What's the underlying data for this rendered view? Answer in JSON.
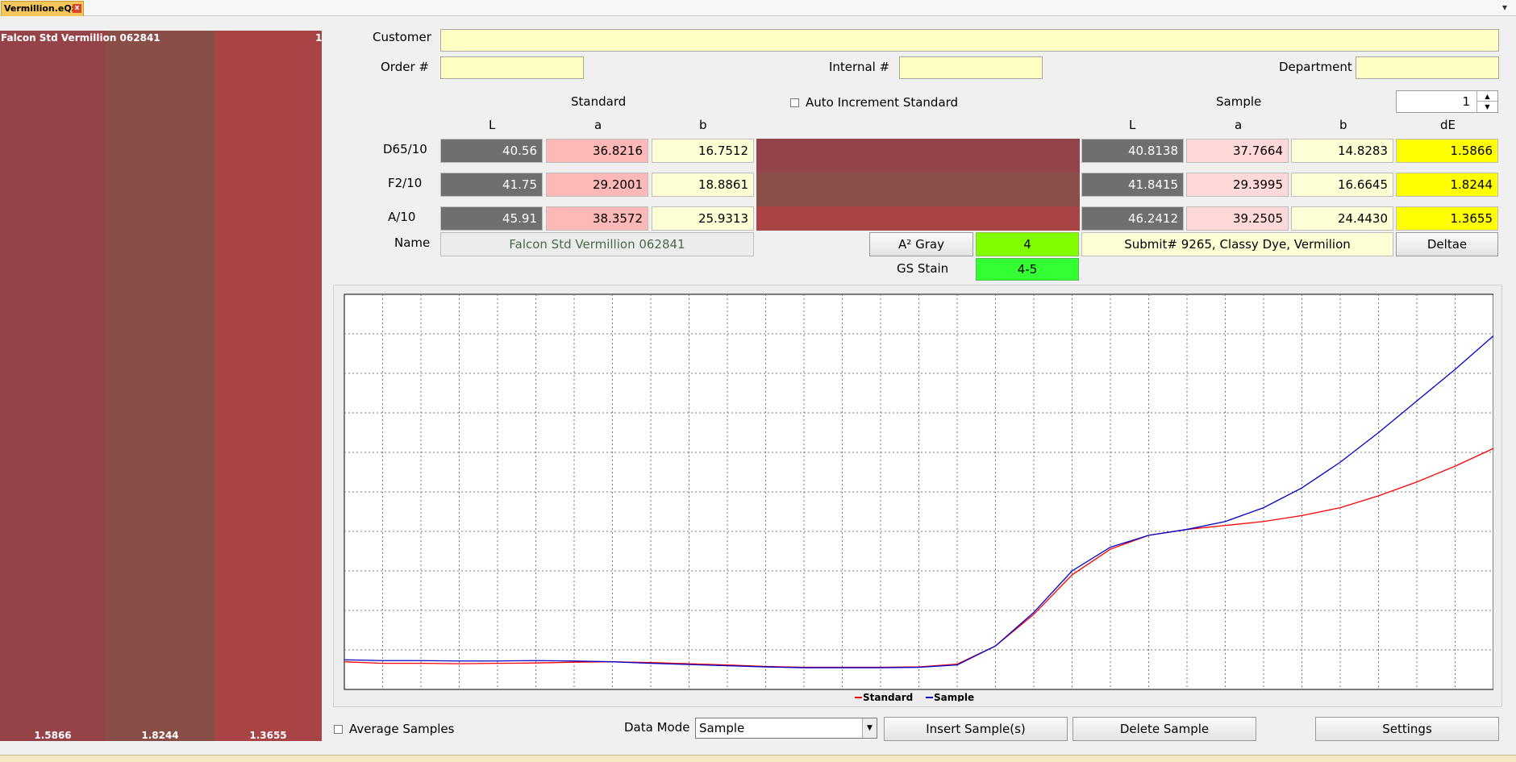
{
  "tab": {
    "title": "Vermillion.eQz",
    "close": "x",
    "menu": "▾"
  },
  "swatches": {
    "title": "Falcon Std Vermillion 062841",
    "index": "1",
    "items": [
      {
        "value": "1.5866",
        "color": "#954348"
      },
      {
        "value": "1.8244",
        "color": "#8a4e48"
      },
      {
        "value": "1.3655",
        "color": "#a94446"
      }
    ]
  },
  "form": {
    "customer_label": "Customer",
    "customer_value": "",
    "order_label": "Order #",
    "order_value": "",
    "internal_label": "Internal #",
    "internal_value": "",
    "department_label": "Department",
    "department_value": ""
  },
  "standard": {
    "heading": "Standard",
    "cols": [
      "L",
      "a",
      "b"
    ],
    "rows": [
      {
        "illum": "D65/10",
        "L": "40.56",
        "a": "36.8216",
        "b": "16.7512"
      },
      {
        "illum": "F2/10",
        "L": "41.75",
        "a": "29.2001",
        "b": "18.8861"
      },
      {
        "illum": "A/10",
        "L": "45.91",
        "a": "38.3572",
        "b": "25.9313"
      }
    ],
    "name_label": "Name",
    "name_value": "Falcon Std Vermillion 062841"
  },
  "auto_increment_label": "Auto Increment Standard",
  "sample": {
    "heading": "Sample",
    "spinner_value": "1",
    "cols": [
      "L",
      "a",
      "b",
      "dE"
    ],
    "rows": [
      {
        "L": "40.8138",
        "a": "37.7664",
        "b": "14.8283",
        "dE": "1.5866"
      },
      {
        "L": "41.8415",
        "a": "29.3995",
        "b": "16.6645",
        "dE": "1.8244"
      },
      {
        "L": "46.2412",
        "a": "39.2505",
        "b": "24.4430",
        "dE": "1.3655"
      }
    ],
    "name_value": "Submit# 9265, Classy Dye, Vermilion"
  },
  "compare_swatch_colors": [
    "#94434a",
    "#8a4e4b",
    "#a94446"
  ],
  "gray": {
    "a2_label": "A² Gray",
    "a2_value": "4",
    "stain_label": "GS Stain",
    "stain_value": "4-5",
    "a2_color": "#7fff00",
    "stain_color": "#33ff33"
  },
  "deltae_button": "Deltae",
  "chart_data": {
    "type": "line",
    "x": [
      0,
      1,
      2,
      3,
      4,
      5,
      6,
      7,
      8,
      9,
      10,
      11,
      12,
      13,
      14,
      15,
      16,
      17,
      18,
      19,
      20,
      21,
      22,
      23,
      24,
      25,
      26,
      27,
      28,
      29,
      30
    ],
    "series": [
      {
        "name": "Standard",
        "color": "#ff0000",
        "values": [
          7.0,
          6.6,
          6.6,
          6.5,
          6.6,
          6.7,
          6.9,
          7.0,
          6.8,
          6.5,
          6.2,
          5.8,
          5.6,
          5.6,
          5.6,
          5.7,
          6.4,
          11.0,
          19.0,
          29.0,
          35.5,
          39.0,
          40.5,
          41.5,
          42.5,
          44.0,
          46.0,
          49.0,
          52.5,
          56.5,
          61.0
        ]
      },
      {
        "name": "Sample",
        "color": "#0000cc",
        "values": [
          7.5,
          7.3,
          7.3,
          7.2,
          7.2,
          7.3,
          7.2,
          7.0,
          6.6,
          6.3,
          6.0,
          5.7,
          5.5,
          5.5,
          5.5,
          5.6,
          6.2,
          11.0,
          19.5,
          30.0,
          36.0,
          39.0,
          40.5,
          42.5,
          46.0,
          51.0,
          57.5,
          65.0,
          73.0,
          81.0,
          89.5
        ]
      }
    ],
    "xlim": [
      0,
      30
    ],
    "ylim": [
      0,
      100
    ],
    "grid": true,
    "legend": "bottom-center"
  },
  "bottom": {
    "average_label": "Average Samples",
    "data_mode_label": "Data Mode",
    "data_mode_value": "Sample",
    "insert_button": "Insert Sample(s)",
    "delete_button": "Delete Sample",
    "settings_button": "Settings"
  }
}
